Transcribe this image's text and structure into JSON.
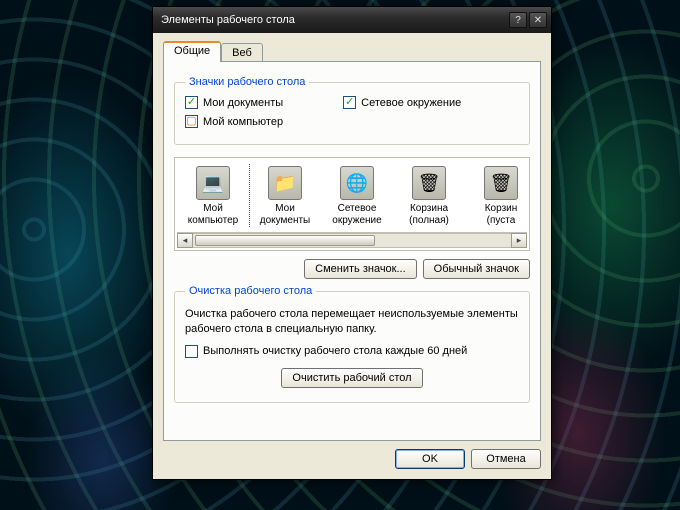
{
  "window": {
    "title": "Элементы рабочего стола"
  },
  "tabs": {
    "general": "Общие",
    "web": "Веб"
  },
  "desktop_icons_group": {
    "legend": "Значки рабочего стола",
    "my_documents": "Мои документы",
    "network": "Сетевое окружение",
    "my_computer": "Мой компьютер"
  },
  "icons": [
    {
      "label_line1": "Мой",
      "label_line2": "компьютер",
      "glyph": "💻"
    },
    {
      "label_line1": "Мои",
      "label_line2": "документы",
      "glyph": "📁"
    },
    {
      "label_line1": "Сетевое",
      "label_line2": "окружение",
      "glyph": "🌐"
    },
    {
      "label_line1": "Корзина",
      "label_line2": "(полная)",
      "glyph": "🗑"
    },
    {
      "label_line1": "Корзин",
      "label_line2": "(пуста",
      "glyph": "🗑"
    }
  ],
  "buttons": {
    "change_icon": "Сменить значок...",
    "default_icon": "Обычный значок",
    "clean_desktop": "Очистить рабочий стол",
    "ok": "OK",
    "cancel": "Отмена"
  },
  "cleanup_group": {
    "legend": "Очистка рабочего стола",
    "description": "Очистка рабочего стола перемещает неиспользуемые элементы рабочего стола в специальную папку.",
    "checkbox_label": "Выполнять очистку рабочего стола каждые 60 дней"
  }
}
